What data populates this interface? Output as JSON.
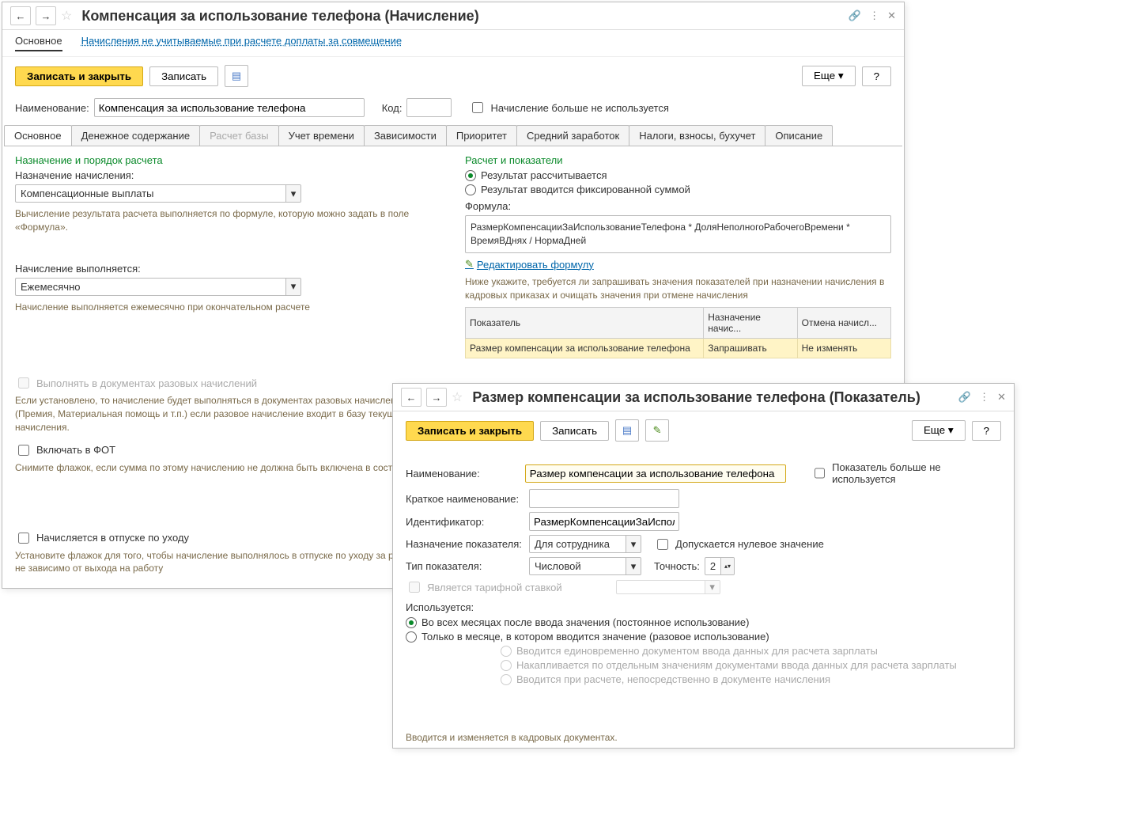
{
  "win1": {
    "title": "Компенсация за использование телефона (Начисление)",
    "linkTabs": {
      "active": "Основное",
      "link": "Начисления не учитываемые при расчете доплаты за совмещение"
    },
    "cmd": {
      "save": "Записать и закрыть",
      "write": "Записать",
      "more": "Еще",
      "help": "?"
    },
    "name": {
      "label": "Наименование:",
      "value": "Компенсация за использование телефона"
    },
    "code": {
      "label": "Код:",
      "value": ""
    },
    "notUsed": "Начисление больше не используется",
    "tabs": [
      "Основное",
      "Денежное содержание",
      "Расчет базы",
      "Учет времени",
      "Зависимости",
      "Приоритет",
      "Средний заработок",
      "Налоги, взносы, бухучет",
      "Описание"
    ],
    "left": {
      "sect": "Назначение и порядок расчета",
      "purposeLabel": "Назначение начисления:",
      "purposeValue": "Компенсационные выплаты",
      "note1": "Вычисление результата расчета выполняется по формуле, которую можно задать в поле «Формула».",
      "execLabel": "Начисление выполняется:",
      "execValue": "Ежемесячно",
      "note2": "Начисление выполняется ежемесячно при окончательном расчете",
      "oneTime": "Выполнять в документах разовых начислений",
      "note3": "Если установлено, то начисление будет выполняться в документах разовых начислений (Премия, Материальная помощь и т.п.) если разовое начисление входит в базу текущего начисления.",
      "fot": "Включать в ФОТ",
      "note4": "Снимите флажок, если сумма по этому начислению не должна быть включена в состав ФОТ",
      "vacation": "Начисляется в отпуске по уходу",
      "note5": "Установите флажок для того, чтобы начисление выполнялось в отпуске по уходу за ребенком не зависимо от выхода на работу"
    },
    "right": {
      "sect": "Расчет и показатели",
      "r1": "Результат рассчитывается",
      "r2": "Результат вводится фиксированной суммой",
      "formulaLabel": "Формула:",
      "formula": "РазмерКомпенсацииЗаИспользованиеТелефона * ДоляНеполногоРабочегоВремени * ВремяВДнях / НормаДней",
      "edit": "Редактировать формулу",
      "tnote": "Ниже укажите, требуется ли запрашивать значения показателей при назначении начисления в кадровых приказах и очищать значения при отмене начисления",
      "th1": "Показатель",
      "th2": "Назначение начис...",
      "th3": "Отмена начисл...",
      "td1": "Размер компенсации за использование телефона",
      "td2": "Запрашивать",
      "td3": "Не изменять"
    }
  },
  "win2": {
    "title": "Размер компенсации за использование телефона (Показатель)",
    "cmd": {
      "save": "Записать и закрыть",
      "write": "Записать",
      "more": "Еще",
      "help": "?"
    },
    "name": {
      "label": "Наименование:",
      "value": "Размер компенсации за использование телефона"
    },
    "notUsed": "Показатель больше не используется",
    "shortName": {
      "label": "Краткое наименование:",
      "value": ""
    },
    "ident": {
      "label": "Идентификатор:",
      "value": "РазмерКомпенсацииЗаИспользов"
    },
    "purpose": {
      "label": "Назначение показателя:",
      "value": "Для сотрудника"
    },
    "allowZero": "Допускается нулевое значение",
    "type": {
      "label": "Тип показателя:",
      "value": "Числовой"
    },
    "precision": {
      "label": "Точность:",
      "value": "2"
    },
    "tariff": "Является тарифной ставкой",
    "usage": {
      "label": "Используется:",
      "r1": "Во всех месяцах после ввода значения (постоянное использование)",
      "r2": "Только в месяце, в котором вводится значение (разовое использование)"
    },
    "sub": {
      "s1": "Вводится единовременно документом ввода данных для расчета зарплаты",
      "s2": "Накапливается по отдельным значениям документами ввода данных для расчета зарплаты",
      "s3": "Вводится при расчете, непосредственно в документе начисления"
    },
    "bottom": "Вводится и изменяется в кадровых документах."
  }
}
